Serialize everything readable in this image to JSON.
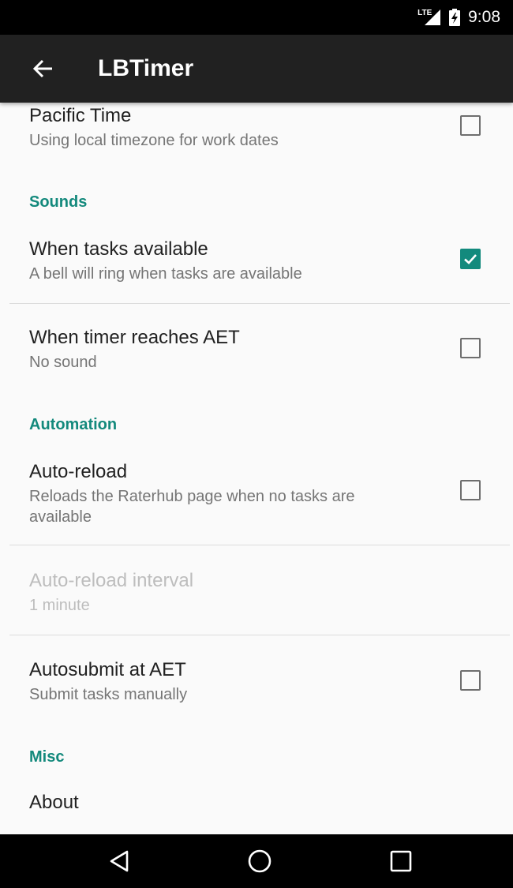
{
  "status_bar": {
    "network_label": "LTE",
    "time": "9:08"
  },
  "app_bar": {
    "title": "LBTimer",
    "back_icon": "arrow-back-icon"
  },
  "settings": [
    {
      "type": "pref",
      "title": "Pacific Time",
      "summary": "Using local timezone for work dates",
      "checked": false
    },
    {
      "type": "category",
      "title": "Sounds"
    },
    {
      "type": "pref",
      "title": "When tasks available",
      "summary": "A bell will ring when tasks are available",
      "checked": true
    },
    {
      "type": "pref",
      "title": "When timer reaches AET",
      "summary": "No sound",
      "checked": false
    },
    {
      "type": "category",
      "title": "Automation"
    },
    {
      "type": "pref",
      "title": "Auto-reload",
      "summary": "Reloads the Raterhub page when no tasks are available",
      "checked": false
    },
    {
      "type": "pref",
      "title": "Auto-reload interval",
      "summary": "1 minute",
      "enabled": false
    },
    {
      "type": "pref",
      "title": "Autosubmit at AET",
      "summary": "Submit tasks manually",
      "checked": false
    },
    {
      "type": "category",
      "title": "Misc"
    },
    {
      "type": "pref",
      "title": "About"
    }
  ],
  "colors": {
    "accent": "#138a7d",
    "category_text": "#13897c",
    "app_bar": "#212121",
    "background": "#fafafa"
  },
  "nav_bar": {
    "back_icon": "triangle-back-icon",
    "home_icon": "circle-home-icon",
    "recents_icon": "square-recents-icon"
  }
}
